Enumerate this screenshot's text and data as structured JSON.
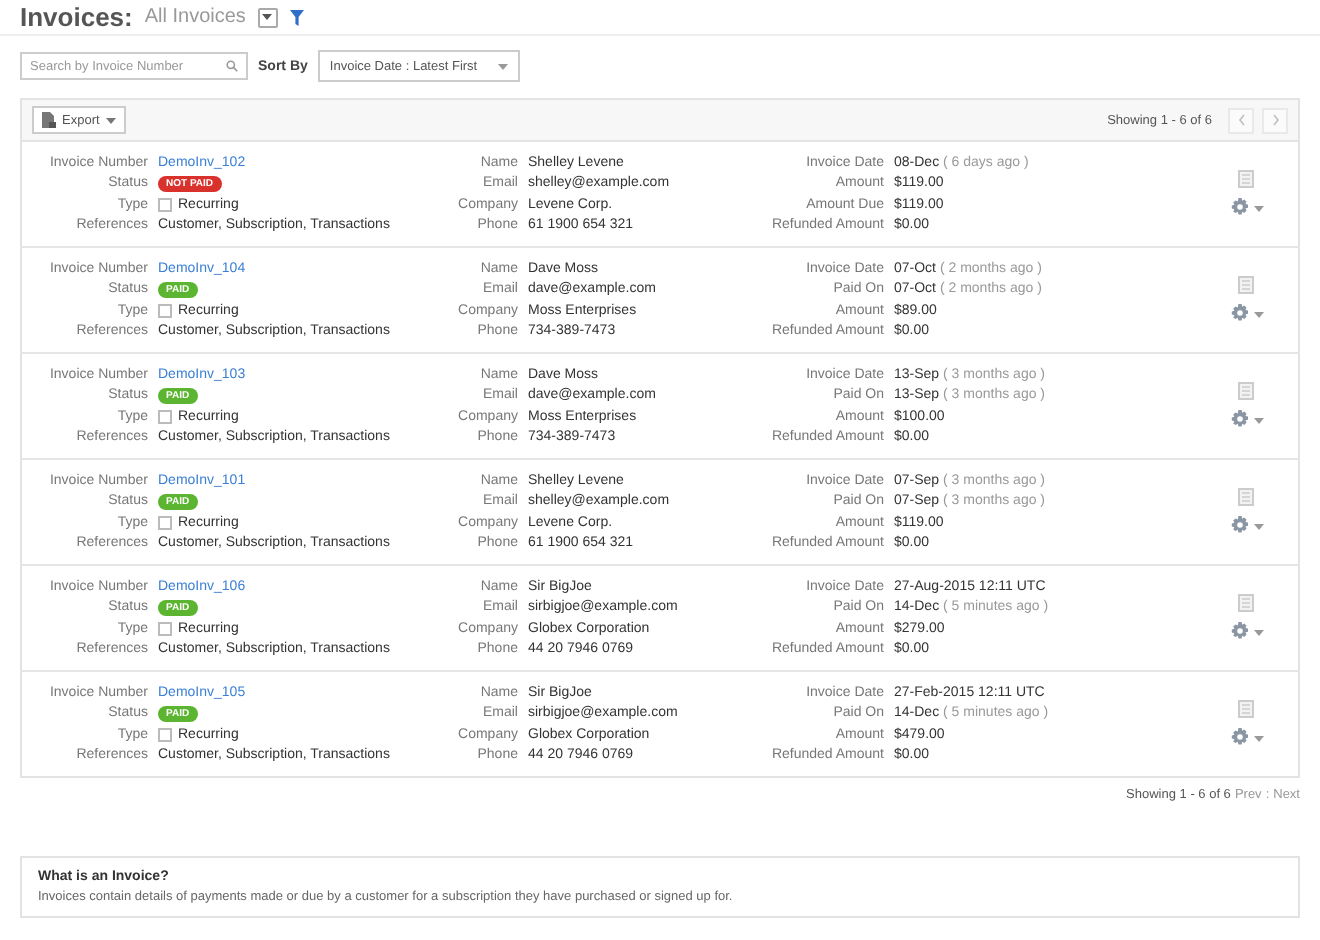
{
  "header": {
    "title": "Invoices:",
    "view": "All Invoices"
  },
  "search": {
    "placeholder": "Search by Invoice Number"
  },
  "sort": {
    "label": "Sort By",
    "value": "Invoice Date : Latest First"
  },
  "toolbar": {
    "export": "Export",
    "showing": "Showing 1 - 6 of 6",
    "prev_disabled": true,
    "next_disabled": true
  },
  "invoices": [
    {
      "number_label": "Invoice Number",
      "number": "DemoInv_102",
      "status_label": "Status",
      "status": "NOT PAID",
      "color": "#d9312b",
      "type_label": "Type",
      "type": "Recurring",
      "recurring_checked": false,
      "references_label": "References",
      "references": "Customer, Subscription, Transactions",
      "contact": [
        {
          "label": "Name",
          "value": "Shelley Levene"
        },
        {
          "label": "Email",
          "value": "shelley@example.com"
        },
        {
          "label": "Company",
          "value": "Levene Corp."
        },
        {
          "label": "Phone",
          "value": "61 1900 654 321"
        }
      ],
      "amounts": [
        {
          "label": "Invoice Date",
          "value": "08-Dec",
          "note": "( 6 days ago )"
        },
        {
          "label": "Amount",
          "value": "$119.00"
        },
        {
          "label": "Amount Due",
          "value": "$119.00"
        },
        {
          "label": "Refunded Amount",
          "value": "$0.00"
        }
      ]
    },
    {
      "number_label": "Invoice Number",
      "number": "DemoInv_104",
      "status_label": "Status",
      "status": "PAID",
      "color": "#5cb531",
      "type_label": "Type",
      "type": "Recurring",
      "recurring_checked": false,
      "references_label": "References",
      "references": "Customer, Subscription, Transactions",
      "contact": [
        {
          "label": "Name",
          "value": "Dave Moss"
        },
        {
          "label": "Email",
          "value": "dave@example.com"
        },
        {
          "label": "Company",
          "value": "Moss Enterprises"
        },
        {
          "label": "Phone",
          "value": "734-389-7473"
        }
      ],
      "amounts": [
        {
          "label": "Invoice Date",
          "value": "07-Oct",
          "note": "( 2 months ago )"
        },
        {
          "label": "Paid On",
          "value": "07-Oct",
          "note": "( 2 months ago )"
        },
        {
          "label": "Amount",
          "value": "$89.00"
        },
        {
          "label": "Refunded Amount",
          "value": "$0.00"
        }
      ]
    },
    {
      "number_label": "Invoice Number",
      "number": "DemoInv_103",
      "status_label": "Status",
      "status": "PAID",
      "color": "#5cb531",
      "type_label": "Type",
      "type": "Recurring",
      "recurring_checked": false,
      "references_label": "References",
      "references": "Customer, Subscription, Transactions",
      "contact": [
        {
          "label": "Name",
          "value": "Dave Moss"
        },
        {
          "label": "Email",
          "value": "dave@example.com"
        },
        {
          "label": "Company",
          "value": "Moss Enterprises"
        },
        {
          "label": "Phone",
          "value": "734-389-7473"
        }
      ],
      "amounts": [
        {
          "label": "Invoice Date",
          "value": "13-Sep",
          "note": "( 3 months ago )"
        },
        {
          "label": "Paid On",
          "value": "13-Sep",
          "note": "( 3 months ago )"
        },
        {
          "label": "Amount",
          "value": "$100.00"
        },
        {
          "label": "Refunded Amount",
          "value": "$0.00"
        }
      ]
    },
    {
      "number_label": "Invoice Number",
      "number": "DemoInv_101",
      "status_label": "Status",
      "status": "PAID",
      "color": "#5cb531",
      "type_label": "Type",
      "type": "Recurring",
      "recurring_checked": false,
      "references_label": "References",
      "references": "Customer, Subscription, Transactions",
      "contact": [
        {
          "label": "Name",
          "value": "Shelley Levene"
        },
        {
          "label": "Email",
          "value": "shelley@example.com"
        },
        {
          "label": "Company",
          "value": "Levene Corp."
        },
        {
          "label": "Phone",
          "value": "61 1900 654 321"
        }
      ],
      "amounts": [
        {
          "label": "Invoice Date",
          "value": "07-Sep",
          "note": "( 3 months ago )"
        },
        {
          "label": "Paid On",
          "value": "07-Sep",
          "note": "( 3 months ago )"
        },
        {
          "label": "Amount",
          "value": "$119.00"
        },
        {
          "label": "Refunded Amount",
          "value": "$0.00"
        }
      ]
    },
    {
      "number_label": "Invoice Number",
      "number": "DemoInv_106",
      "status_label": "Status",
      "status": "PAID",
      "color": "#5cb531",
      "type_label": "Type",
      "type": "Recurring",
      "recurring_checked": false,
      "references_label": "References",
      "references": "Customer, Subscription, Transactions",
      "contact": [
        {
          "label": "Name",
          "value": "Sir BigJoe"
        },
        {
          "label": "Email",
          "value": "sirbigjoe@example.com"
        },
        {
          "label": "Company",
          "value": "Globex Corporation"
        },
        {
          "label": "Phone",
          "value": "44 20 7946 0769"
        }
      ],
      "amounts": [
        {
          "label": "Invoice Date",
          "value": "27-Aug-2015 12:11 UTC"
        },
        {
          "label": "Paid On",
          "value": "14-Dec",
          "note": "( 5 minutes ago )"
        },
        {
          "label": "Amount",
          "value": "$279.00"
        },
        {
          "label": "Refunded Amount",
          "value": "$0.00"
        }
      ]
    },
    {
      "number_label": "Invoice Number",
      "number": "DemoInv_105",
      "status_label": "Status",
      "status": "PAID",
      "color": "#5cb531",
      "type_label": "Type",
      "type": "Recurring",
      "recurring_checked": false,
      "references_label": "References",
      "references": "Customer, Subscription, Transactions",
      "contact": [
        {
          "label": "Name",
          "value": "Sir BigJoe"
        },
        {
          "label": "Email",
          "value": "sirbigjoe@example.com"
        },
        {
          "label": "Company",
          "value": "Globex Corporation"
        },
        {
          "label": "Phone",
          "value": "44 20 7946 0769"
        }
      ],
      "amounts": [
        {
          "label": "Invoice Date",
          "value": "27-Feb-2015 12:11 UTC"
        },
        {
          "label": "Paid On",
          "value": "14-Dec",
          "note": "( 5 minutes ago )"
        },
        {
          "label": "Amount",
          "value": "$479.00"
        },
        {
          "label": "Refunded Amount",
          "value": "$0.00"
        }
      ]
    }
  ],
  "footer": {
    "showing": "Showing 1 - 6 of 6",
    "prev": "Prev",
    "separator": ":",
    "next": "Next"
  },
  "info": {
    "title": "What is an Invoice?",
    "text": "Invoices contain details of payments made or due by a customer for a subscription they have purchased or signed up for."
  }
}
